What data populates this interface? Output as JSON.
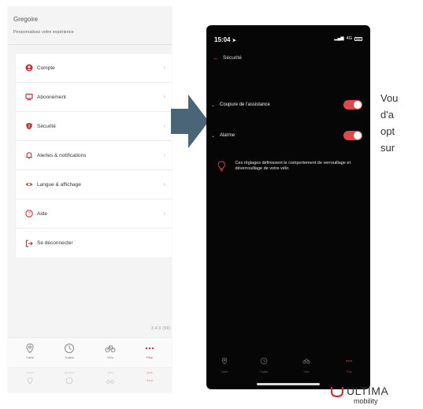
{
  "left_screen": {
    "user_name": "Gregoire",
    "subtitle": "Personnalisez votre expérience",
    "menu": [
      {
        "label": "Compte",
        "icon": "user-icon"
      },
      {
        "label": "Abonnement",
        "icon": "monitor-icon"
      },
      {
        "label": "Sécurité",
        "icon": "shield-icon"
      },
      {
        "label": "Alertes & notifications",
        "icon": "bell-icon"
      },
      {
        "label": "Langue & affichage",
        "icon": "eye-icon"
      },
      {
        "label": "Aide",
        "icon": "help-icon"
      },
      {
        "label": "Se déconnecter",
        "icon": "logout-icon"
      }
    ],
    "page_counter": "3.4.0 (56)",
    "tabs": [
      {
        "label": "Carte",
        "icon": "map-pin-icon"
      },
      {
        "label": "Trajets",
        "icon": "clock-icon"
      },
      {
        "label": "Vélo",
        "icon": "bike-icon"
      },
      {
        "label": "Plus",
        "icon": "more-icon"
      }
    ],
    "ghost_tabs": [
      "cover",
      "guides",
      "vélo",
      "plus"
    ]
  },
  "phone": {
    "time": "15:04",
    "network": "4G",
    "back_title": "Sécurité",
    "settings": [
      {
        "label": "Coupure de l'assistance",
        "enabled": true
      },
      {
        "label": "Alarme",
        "enabled": true
      }
    ],
    "info_text": "Ces réglages définissent le comportement de verrouillage et déverrouillage de votre vélo.",
    "tabs": [
      {
        "label": "Carte",
        "icon": "map-pin-icon"
      },
      {
        "label": "Trajets",
        "icon": "clock-icon"
      },
      {
        "label": "Vélo",
        "icon": "bike-icon"
      },
      {
        "label": "Plus",
        "icon": "more-icon"
      }
    ]
  },
  "side_text": [
    "Vou",
    "d'a",
    "opt",
    "sur"
  ],
  "logo": {
    "word": "ULTIMA",
    "sub": "mobility"
  },
  "colors": {
    "accent": "#e04848",
    "arrow": "#4a6478",
    "dark_bg": "#060606"
  }
}
